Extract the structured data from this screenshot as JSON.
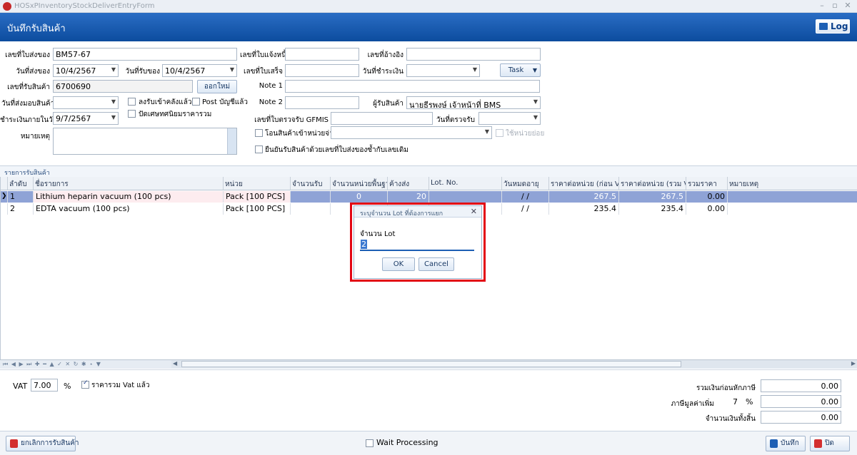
{
  "window": {
    "title": "HOSxPInventoryStockDeliverEntryForm",
    "minimize": "–",
    "restore": "▫",
    "close": "✕"
  },
  "header": {
    "title": "บันทึกรับสินค้า",
    "log_button": "Log"
  },
  "form": {
    "delivery_no_label": "เลขที่ใบส่งของ",
    "delivery_no": "BM57-67",
    "send_date_label": "วันที่ส่งของ",
    "send_date": "10/4/2567",
    "receive_date_label": "วันที่รับของ",
    "receive_date": "10/4/2567",
    "receive_no_label": "เลขที่รับสินค้า",
    "receive_no": "6700690",
    "new_button": "ออกใหม่",
    "deliver_date_label": "วันที่ส่งมอบสินค้า",
    "deliver_date": "",
    "stock_checkbox": "ลงรับเข้าคลังแล้ว",
    "post_checkbox": "Post บัญชีแล้ว",
    "round_checkbox": "ปัดเศษทศนิยมราคารวม",
    "pay_within_label": "ชำระเงินภายในวันที่",
    "pay_within": "9/7/2567",
    "remark_label": "หมายเหตุ",
    "remark": "",
    "debt_no_label": "เลขที่ใบแจ้งหนี้",
    "debt_no": "",
    "receipt_no_label": "เลขที่ใบเสร็จ",
    "receipt_no": "",
    "note1_label": "Note 1",
    "note1": "",
    "note2_label": "Note 2",
    "note2": "",
    "gfmis_label": "เลขที่ใบตรวจรับ GFMIS",
    "gfmis": "",
    "transfer_checkbox": "โอนสินค้าเข้าหน่วยจ่าย",
    "transfer_value": "",
    "use_subunit": "ใช้หน่วยย่อย",
    "confirm_checkbox": "ยืนยันรับสินค้าด้วยเลขที่ใบส่งของซ้ำกับเลขเดิม",
    "ref_no_label": "เลขที่อ้างอิง",
    "ref_no": "",
    "pay_date_label": "วันที่ชำระเงิน",
    "pay_date": "",
    "task_button": "Task",
    "receiver_label": "ผู้รับสินค้า",
    "receiver": "นายธีรพงษ์ เจ้าหน้าที่ BMS",
    "check_date_label": "วันที่ตรวจรับ",
    "check_date": ""
  },
  "section_title": "รายการรับสินค้า",
  "grid": {
    "columns": [
      "ลำดับ",
      "ชื่อรายการ",
      "หน่วย",
      "จำนวนรับ",
      "จำนวนหน่วยพื้นฐาน",
      "ค้างส่ง",
      "Lot. No.",
      "วันหมดอายุ",
      "ราคาต่อหน่วย (ก่อน Vat)",
      "ราคาต่อหน่วย (รวม Vat)",
      "รวมราคา",
      "หมายเหตุ"
    ],
    "rows": [
      {
        "no": "1",
        "name": "Lithium heparin vacuum (100 pcs)",
        "unit": "Pack [100 PCS]",
        "qty": "",
        "base_qty": "0",
        "backorder": "20",
        "lot": "",
        "expiry": "/ /",
        "price_ex": "267.5",
        "price_in": "267.5",
        "total": "0.00",
        "note": ""
      },
      {
        "no": "2",
        "name": "EDTA vacuum (100 pcs)",
        "unit": "Pack [100 PCS]",
        "qty": "",
        "base_qty": "",
        "backorder": "",
        "lot": "",
        "expiry": "/ /",
        "price_ex": "235.4",
        "price_in": "235.4",
        "total": "0.00",
        "note": ""
      }
    ],
    "navigator": "⏮ ◀ ▶ ⏭ ✚ ━ ▲ ✓ ✕ ↻ ✱ ⋆ ▼"
  },
  "dialog": {
    "title": "ระบุจำนวน Lot ที่ต้องการแยก",
    "field_label": "จำนวน Lot",
    "field_value": "2",
    "ok_button": "OK",
    "cancel_button": "Cancel"
  },
  "footer": {
    "vat_label": "VAT",
    "vat_value": "7.00",
    "percent": "%",
    "vat_included_checkbox": "ราคารวม Vat แล้ว",
    "subtotal_label": "รวมเงินก่อนหักภาษี",
    "subtotal": "0.00",
    "vat_amount_label": "ภาษีมูลค่าเพิ่ม",
    "vat_rate": "7",
    "vat_amount": "0.00",
    "grand_total_label": "จำนวนเงินทั้งสิ้น",
    "grand_total": "0.00"
  },
  "bottom": {
    "cancel_receive_button": "ยกเลิกการรับสินค้า",
    "wait_processing": "Wait Processing",
    "save_button": "บันทึก",
    "close_button": "ปิด"
  },
  "colors": {
    "header_blue": "#0c4c9e",
    "selected_row": "#8fa3d6",
    "highlight_red": "#e30613"
  }
}
